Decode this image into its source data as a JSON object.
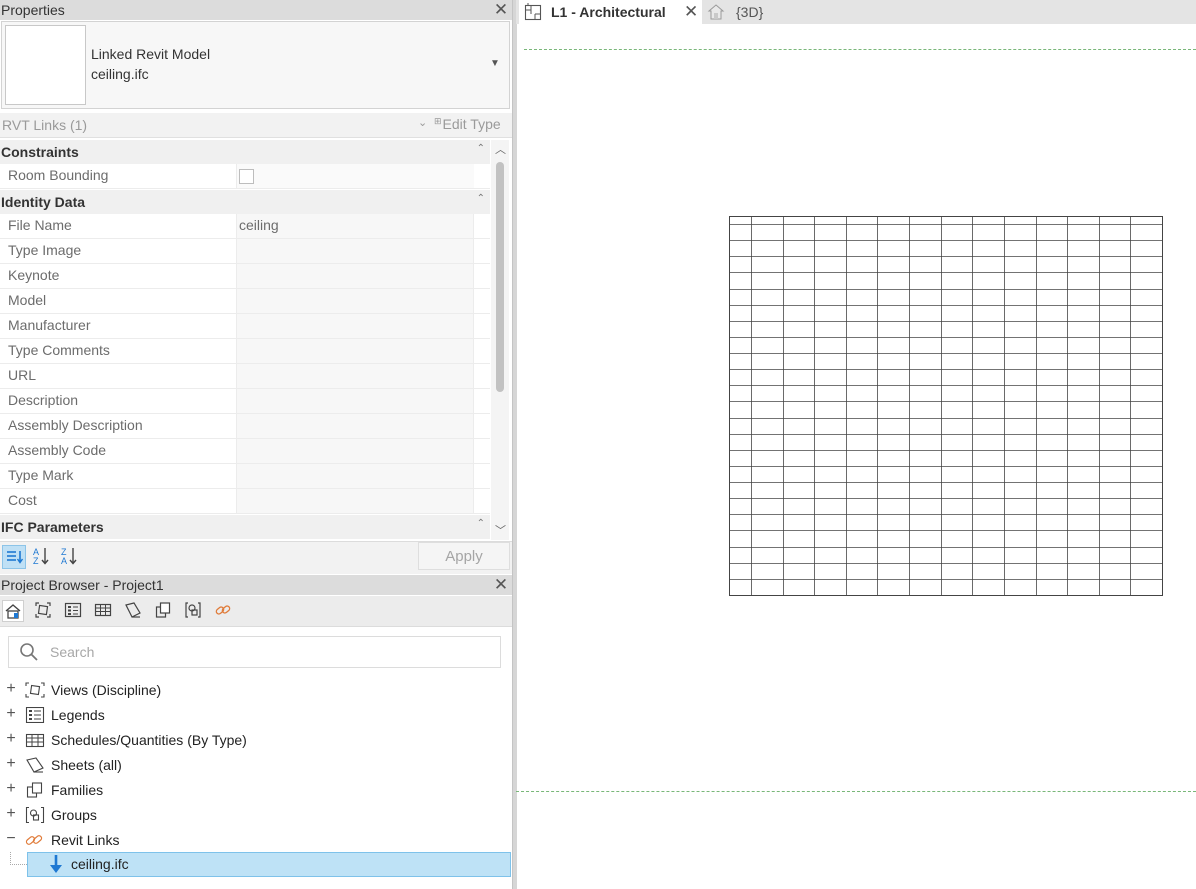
{
  "properties": {
    "title": "Properties",
    "type_name_line1": "Linked Revit Model",
    "type_name_line2": "ceiling.ifc",
    "selector_label": "RVT Links (1)",
    "edit_type_label": "Edit Type",
    "groups": {
      "constraints": "Constraints",
      "identity": "Identity Data",
      "ifc": "IFC Parameters"
    },
    "constraints_rows": [
      {
        "name": "Room Bounding",
        "value": "",
        "checkbox": true,
        "checked": false
      }
    ],
    "identity_rows": [
      {
        "name": "File Name",
        "value": "ceiling"
      },
      {
        "name": "Type Image",
        "value": ""
      },
      {
        "name": "Keynote",
        "value": ""
      },
      {
        "name": "Model",
        "value": ""
      },
      {
        "name": "Manufacturer",
        "value": ""
      },
      {
        "name": "Type Comments",
        "value": ""
      },
      {
        "name": "URL",
        "value": ""
      },
      {
        "name": "Description",
        "value": ""
      },
      {
        "name": "Assembly Description",
        "value": ""
      },
      {
        "name": "Assembly Code",
        "value": ""
      },
      {
        "name": "Type Mark",
        "value": ""
      },
      {
        "name": "Cost",
        "value": ""
      }
    ],
    "apply_label": "Apply"
  },
  "project_browser": {
    "title": "Project Browser - Project1",
    "search_placeholder": "Search",
    "tree": [
      {
        "label": "Views (Discipline)",
        "expander": "+",
        "icon": "views-icon"
      },
      {
        "label": "Legends",
        "expander": "+",
        "icon": "legends-icon"
      },
      {
        "label": "Schedules/Quantities (By Type)",
        "expander": "+",
        "icon": "schedules-icon"
      },
      {
        "label": "Sheets (all)",
        "expander": "+",
        "icon": "sheets-icon"
      },
      {
        "label": "Families",
        "expander": "+",
        "icon": "families-icon"
      },
      {
        "label": "Groups",
        "expander": "+",
        "icon": "groups-icon"
      },
      {
        "label": "Revit Links",
        "expander": "−",
        "icon": "revit-links-icon"
      }
    ],
    "selected_child": "ceiling.ifc"
  },
  "viewport": {
    "tabs": [
      {
        "label": "L1 - Architectural",
        "active": true
      },
      {
        "label": "{3D}",
        "active": false
      }
    ],
    "ceiling_grid": {
      "columns": 13,
      "rows": 23
    }
  },
  "colors": {
    "selection_fill": "#bee2f6",
    "crop_dash": "#79b779",
    "link_icon": "#e07b39",
    "arrow_blue": "#1e78d2"
  }
}
